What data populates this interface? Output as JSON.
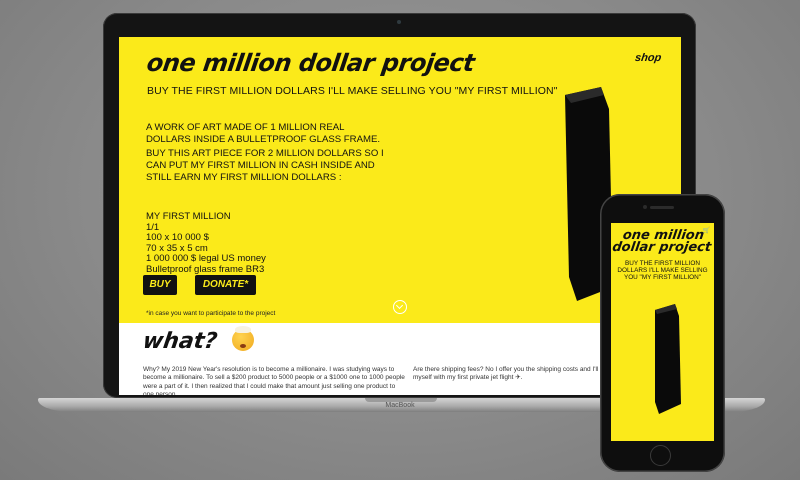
{
  "site": {
    "brand": "one million dollar project",
    "nav_shop": "shop",
    "subtitle": "BUY THE FIRST MILLION DOLLARS I'LL MAKE SELLING YOU \"MY FIRST MILLION\"",
    "description_1": "A WORK OF ART MADE OF 1 MILLION REAL DOLLARS INSIDE A BULLETPROOF GLASS FRAME.",
    "description_2": "BUY THIS ART PIECE FOR 2 MILLION DOLLARS SO I CAN PUT MY FIRST MILLION IN CASH INSIDE AND STILL EARN MY FIRST MILLION DOLLARS :",
    "specs": [
      "MY FIRST MILLION",
      "1/1",
      "100 x 10 000 $",
      "70 x 35 x 5 cm",
      "1 000 000 $ legal US money",
      "Bulletproof glass frame BR3"
    ],
    "buy_label": "BUY",
    "donate_label": "DONATE*",
    "footnote": "*in case you want to participate to the project",
    "what_title": "what?",
    "what_col1": "Why? My 2019 New Year's resolution is to become a millionaire. I was studying ways to become a millionaire. To sell a $200 product to 5000 people or a $1000 one to 1000 people were a part of it. I then realized that I could make that amount just selling one product to one person.",
    "what_col2": "Are there shipping fees? No I offer you the shipping costs and I'll deliver \"My First Million\" to you myself with my first private jet flight ✈."
  },
  "device_labels": {
    "laptop": "MacBook"
  },
  "phone": {
    "brand_line1": "one million",
    "brand_line2": "dollar project",
    "subtitle": "BUY THE FIRST MILLION DOLLARS I'LL MAKE SELLING YOU \"MY FIRST MILLION\""
  },
  "colors": {
    "accent": "#fbea1a",
    "ink": "#111111",
    "background": "#8a8a8a"
  },
  "icons": {
    "scroll": "chevron-down-circle-icon",
    "cart": "cart-icon",
    "emoji": "exploding-head-icon"
  }
}
